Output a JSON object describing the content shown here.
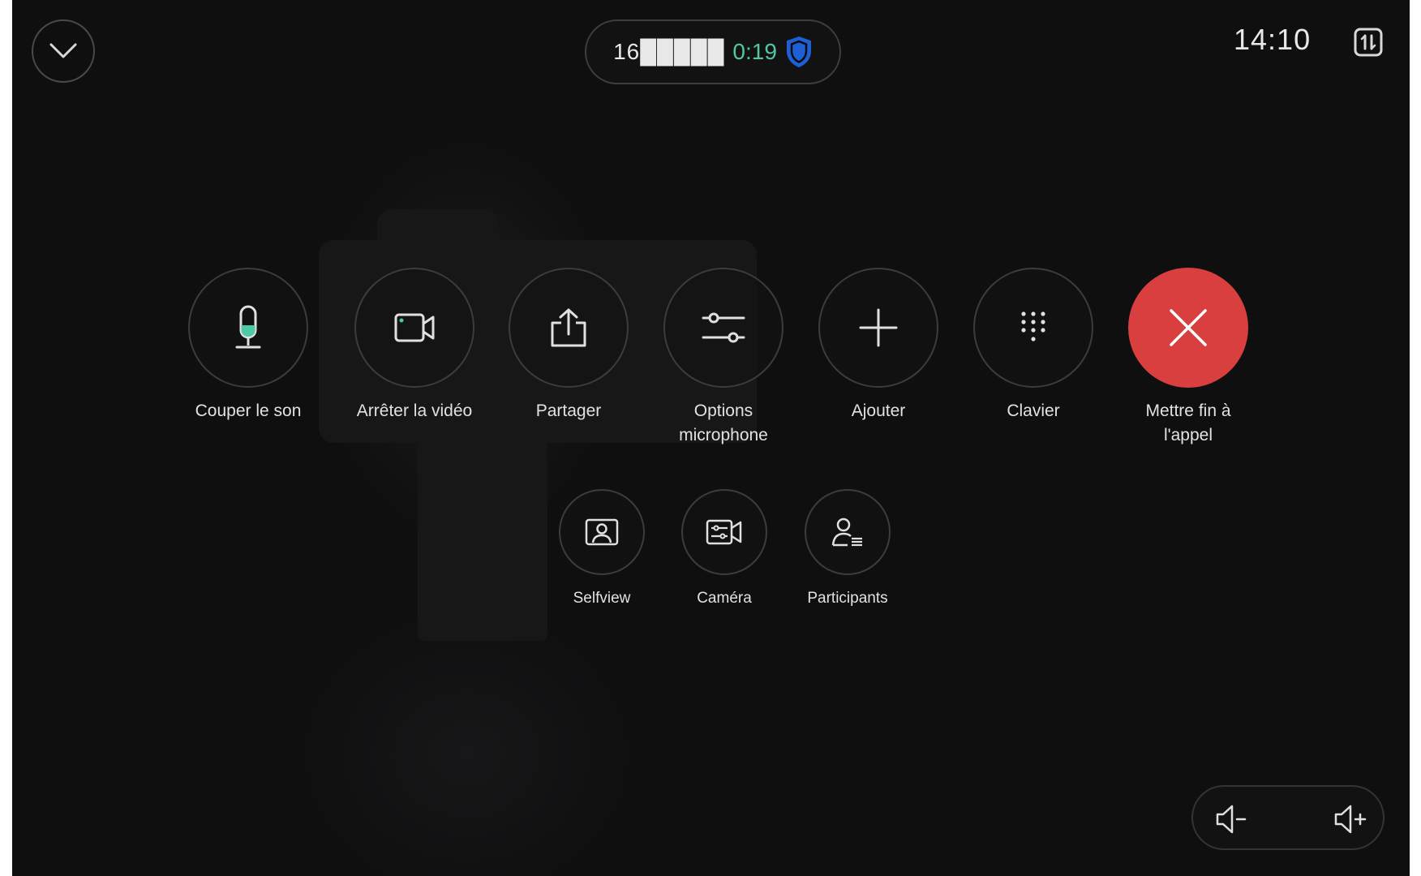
{
  "header": {
    "call_number": "16█████",
    "call_duration": "0:19",
    "clock": "14:10"
  },
  "controls_primary": [
    {
      "label": "Couper le son",
      "icon": "microphone-icon"
    },
    {
      "label": "Arrêter la vidéo",
      "icon": "video-camera-icon"
    },
    {
      "label": "Partager",
      "icon": "share-icon"
    },
    {
      "label": "Options\nmicrophone",
      "icon": "sliders-icon"
    },
    {
      "label": "Ajouter",
      "icon": "plus-icon"
    },
    {
      "label": "Clavier",
      "icon": "keypad-icon"
    },
    {
      "label": "Mettre fin à\nl'appel",
      "icon": "close-icon"
    }
  ],
  "controls_secondary": [
    {
      "label": "Selfview",
      "icon": "selfview-icon"
    },
    {
      "label": "Caméra",
      "icon": "camera-settings-icon"
    },
    {
      "label": "Participants",
      "icon": "participants-icon"
    }
  ],
  "colors": {
    "end_call": "#d93f3f",
    "duration": "#4fc8a5",
    "shield": "#1f5fd6",
    "mic_accent": "#4fc8a5"
  }
}
